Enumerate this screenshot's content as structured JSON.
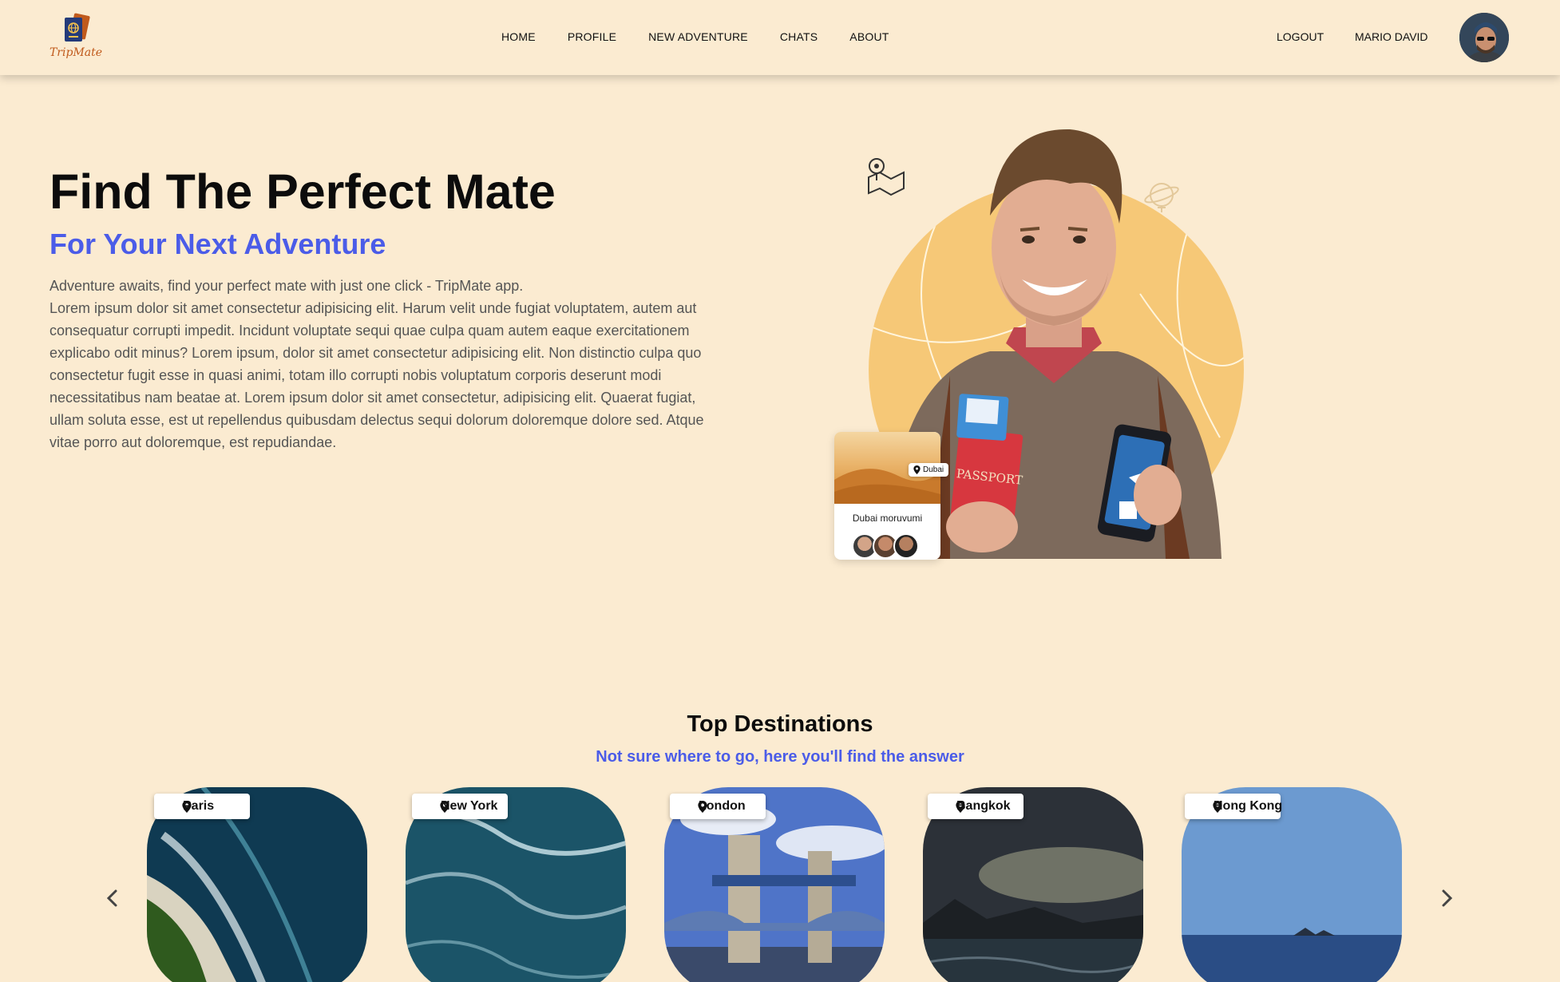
{
  "app": {
    "logo_text": "TripMate"
  },
  "nav": {
    "links": [
      "HOME",
      "PROFILE",
      "NEW ADVENTURE",
      "CHATS",
      "ABOUT"
    ],
    "logout": "LOGOUT",
    "user_name": "MARIO DAVID"
  },
  "hero": {
    "title": "Find The Perfect Mate",
    "subtitle": "For Your Next Adventure",
    "intro": "Adventure awaits, find your perfect mate with just one click - TripMate app.",
    "body": "Lorem ipsum dolor sit amet consectetur adipisicing elit. Harum velit unde fugiat voluptatem, autem aut consequatur corrupti impedit. Incidunt voluptate sequi quae culpa quam autem eaque exercitationem explicabo odit minus? Lorem ipsum, dolor sit amet consectetur adipisicing elit. Non distinctio culpa quo consectetur fugit esse in quasi animi, totam illo corrupti nobis voluptatum corporis deserunt modi necessitatibus nam beatae at. Lorem ipsum dolor sit amet consectetur, adipisicing elit. Quaerat fugiat, ullam soluta esse, est ut repellendus quibusdam delectus sequi dolorum doloremque dolore sed. Atque vitae porro aut doloremque, est repudiandae.",
    "mini_card": {
      "pin": "Dubai",
      "title": "Dubai moruvumi"
    },
    "passport_text": "PASSPORT"
  },
  "destinations": {
    "title": "Top Destinations",
    "subtitle": "Not sure where to go, here you'll find the answer",
    "items": [
      {
        "name": "Paris"
      },
      {
        "name": "New York"
      },
      {
        "name": "London"
      },
      {
        "name": "Bangkok"
      },
      {
        "name": "Hong Kong"
      }
    ]
  },
  "colors": {
    "background": "#fbebd1",
    "accent": "#4b5ce8",
    "sun": "#f6c877"
  }
}
